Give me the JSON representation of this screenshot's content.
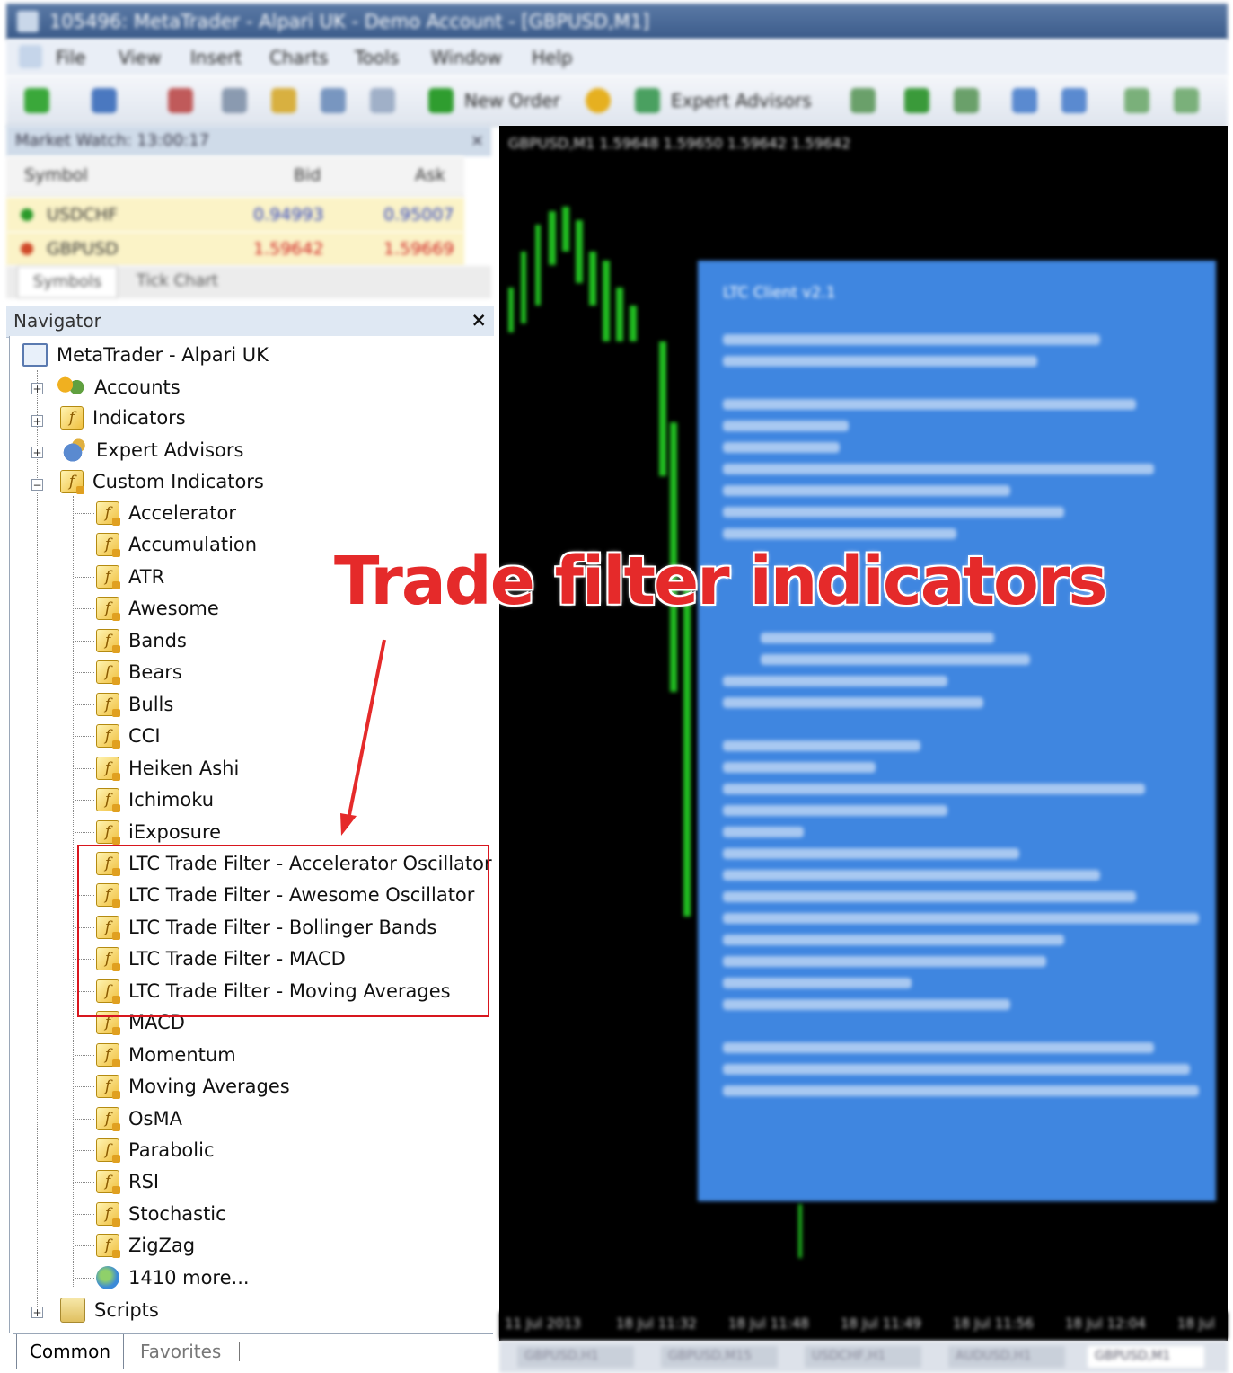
{
  "window": {
    "title": "105496: MetaTrader - Alpari UK - Demo Account - [GBPUSD,M1]"
  },
  "menu": [
    "File",
    "View",
    "Insert",
    "Charts",
    "Tools",
    "Window",
    "Help"
  ],
  "toolbar": {
    "new_order": "New Order",
    "expert_advisors": "Expert Advisors"
  },
  "market_watch": {
    "title": "Market Watch: 13:00:17",
    "columns": [
      "Symbol",
      "Bid",
      "Ask"
    ],
    "rows": [
      {
        "symbol": "USDCHF",
        "bid": "0.94993",
        "ask": "0.95007"
      },
      {
        "symbol": "GBPUSD",
        "bid": "1.59642",
        "ask": "1.59669"
      }
    ],
    "tabs": [
      "Symbols",
      "Tick Chart"
    ]
  },
  "navigator": {
    "title": "Navigator",
    "close": "×",
    "root": "MetaTrader - Alpari UK",
    "groups": [
      "Accounts",
      "Indicators",
      "Expert Advisors",
      "Custom Indicators"
    ],
    "custom_indicators": [
      "Accelerator",
      "Accumulation",
      "ATR",
      "Awesome",
      "Bands",
      "Bears",
      "Bulls",
      "CCI",
      "Heiken Ashi",
      "Ichimoku",
      "iExposure",
      "LTC Trade Filter - Accelerator Oscillator",
      "LTC Trade Filter - Awesome Oscillator",
      "LTC Trade Filter - Bollinger Bands",
      "LTC Trade Filter - MACD",
      "LTC Trade Filter - Moving Averages",
      "MACD",
      "Momentum",
      "Moving Averages",
      "OsMA",
      "Parabolic",
      "RSI",
      "Stochastic",
      "ZigZag",
      "1410 more..."
    ],
    "scripts": "Scripts",
    "tabs": [
      "Common",
      "Favorites"
    ]
  },
  "chart": {
    "header": "GBPUSD,M1 1.59648 1.59650 1.59642 1.59642",
    "panel_title": "LTC Client v2.1",
    "time_labels": [
      "11 Jul 2013",
      "18 Jul 11:32",
      "18 Jul 11:48",
      "18 Jul 11:49",
      "18 Jul 11:56",
      "18 Jul 12:04",
      "18 Jul"
    ],
    "tabs": [
      "GBPUSD,H1",
      "GBPUSD,M15",
      "USDCHF,H1",
      "AUDUSD,H1",
      "GBPUSD,M1"
    ]
  },
  "annotation": {
    "text": "Trade filter indicators",
    "color": "#e52a2a"
  }
}
